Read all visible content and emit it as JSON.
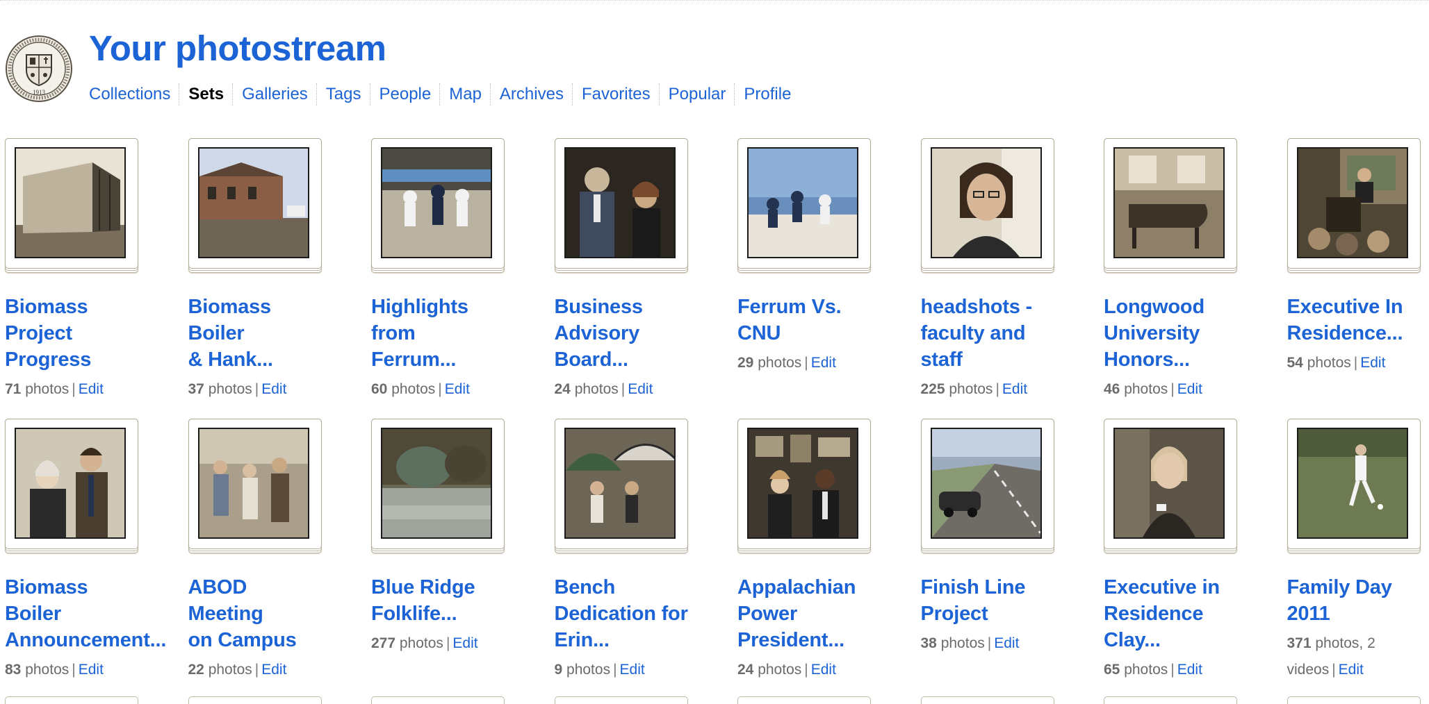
{
  "header": {
    "title": "Your photostream",
    "avatar_icon": "college-seal-icon",
    "avatar_year": "1913"
  },
  "nav": [
    {
      "label": "Collections",
      "active": false
    },
    {
      "label": "Sets",
      "active": true
    },
    {
      "label": "Galleries",
      "active": false
    },
    {
      "label": "Tags",
      "active": false
    },
    {
      "label": "People",
      "active": false
    },
    {
      "label": "Map",
      "active": false
    },
    {
      "label": "Archives",
      "active": false
    },
    {
      "label": "Favorites",
      "active": false
    },
    {
      "label": "Popular",
      "active": false
    },
    {
      "label": "Profile",
      "active": false
    }
  ],
  "sets": [
    {
      "title_lines": [
        "Biomass",
        "Project",
        "Progress"
      ],
      "count": "71",
      "count_text": " photos",
      "edit": "Edit",
      "thumb": "building-photo"
    },
    {
      "title_lines": [
        "Biomass Boiler",
        "& Hank..."
      ],
      "count": "37",
      "count_text": " photos",
      "edit": "Edit",
      "thumb": "brick-building-photo"
    },
    {
      "title_lines": [
        "Highlights from",
        "Ferrum..."
      ],
      "count": "60",
      "count_text": " photos",
      "edit": "Edit",
      "thumb": "football-photo"
    },
    {
      "title_lines": [
        "Business",
        "Advisory",
        "Board..."
      ],
      "count": "24",
      "count_text": " photos",
      "edit": "Edit",
      "thumb": "reception-photo"
    },
    {
      "title_lines": [
        "Ferrum Vs.",
        "CNU"
      ],
      "count": "29",
      "count_text": " photos",
      "edit": "Edit",
      "thumb": "football-crowd-photo"
    },
    {
      "title_lines": [
        "headshots -",
        "faculty and",
        "staff"
      ],
      "count": "225",
      "count_text": " photos",
      "edit": "Edit",
      "thumb": "headshot-photo"
    },
    {
      "title_lines": [
        "Longwood",
        "University",
        "Honors..."
      ],
      "count": "46",
      "count_text": " photos",
      "edit": "Edit",
      "thumb": "piano-room-photo"
    },
    {
      "title_lines": [
        "Executive In",
        "Residence..."
      ],
      "count": "54",
      "count_text": " photos",
      "edit": "Edit",
      "thumb": "lecture-photo"
    },
    {
      "title_lines": [
        "Biomass Boiler",
        "Announcement..."
      ],
      "count": "83",
      "count_text": " photos",
      "edit": "Edit",
      "thumb": "two-people-photo"
    },
    {
      "title_lines": [
        "ABOD Meeting",
        "on Campus"
      ],
      "count": "22",
      "count_text": " photos",
      "edit": "Edit",
      "thumb": "meeting-photo"
    },
    {
      "title_lines": [
        "Blue Ridge",
        "Folklife..."
      ],
      "count": "277",
      "count_text": " photos",
      "edit": "Edit",
      "thumb": "pond-photo"
    },
    {
      "title_lines": [
        "Bench",
        "Dedication for",
        "Erin..."
      ],
      "count": "9",
      "count_text": " photos",
      "edit": "Edit",
      "thumb": "umbrella-photo"
    },
    {
      "title_lines": [
        "Appalachian",
        "Power",
        "President..."
      ],
      "count": "24",
      "count_text": " photos",
      "edit": "Edit",
      "thumb": "office-photo"
    },
    {
      "title_lines": [
        "Finish Line",
        "Project"
      ],
      "count": "38",
      "count_text": " photos",
      "edit": "Edit",
      "thumb": "road-car-photo"
    },
    {
      "title_lines": [
        "Executive in",
        "Residence",
        "Clay..."
      ],
      "count": "65",
      "count_text": " photos",
      "edit": "Edit",
      "thumb": "woman-portrait-photo"
    },
    {
      "title_lines": [
        "Family Day",
        "2011"
      ],
      "count": "371",
      "count_text": " photos, 2",
      "count_text2": "videos",
      "edit": "Edit",
      "thumb": "soccer-player-photo"
    }
  ]
}
